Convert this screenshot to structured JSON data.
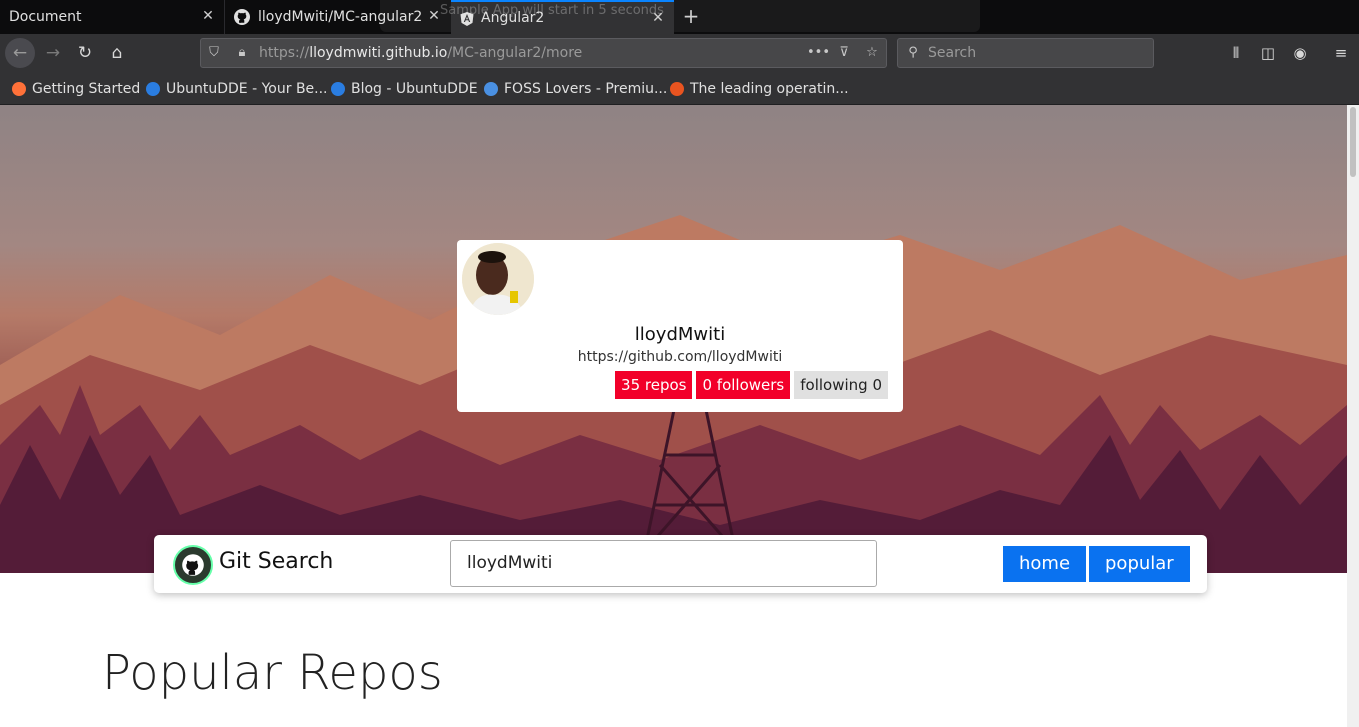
{
  "browser": {
    "tabs": [
      {
        "title": "Document"
      },
      {
        "title": "lloydMwiti/MC-angular2"
      },
      {
        "title": "Angular2"
      }
    ],
    "toast": "Sample App will start in 5 seconds",
    "url": {
      "prefix": "https://",
      "domain": "lloydmwiti.github.io",
      "path": "/MC-angular2/more"
    },
    "search_placeholder": "Search",
    "bookmarks": [
      {
        "label": "Getting Started",
        "color": "#ff7139"
      },
      {
        "label": "UbuntuDDE - Your Be...",
        "color": "#2a7de1"
      },
      {
        "label": "Blog - UbuntuDDE",
        "color": "#2a7de1"
      },
      {
        "label": "FOSS Lovers - Premiu...",
        "color": "#4a90e2"
      },
      {
        "label": "The leading operatin...",
        "color": "#e95420"
      }
    ]
  },
  "profile": {
    "username": "lloydMwiti",
    "url": "https://github.com/lloydMwiti",
    "repos": "35 repos",
    "followers": "0 followers",
    "following": "following 0"
  },
  "searchbar": {
    "brand": "Git Search",
    "query": "lloydMwiti",
    "nav": {
      "home": "home",
      "popular": "popular"
    }
  },
  "section": {
    "heading": "Popular Repos"
  },
  "colors": {
    "accent": "#0a72f0",
    "badge_red": "#f2002a"
  }
}
